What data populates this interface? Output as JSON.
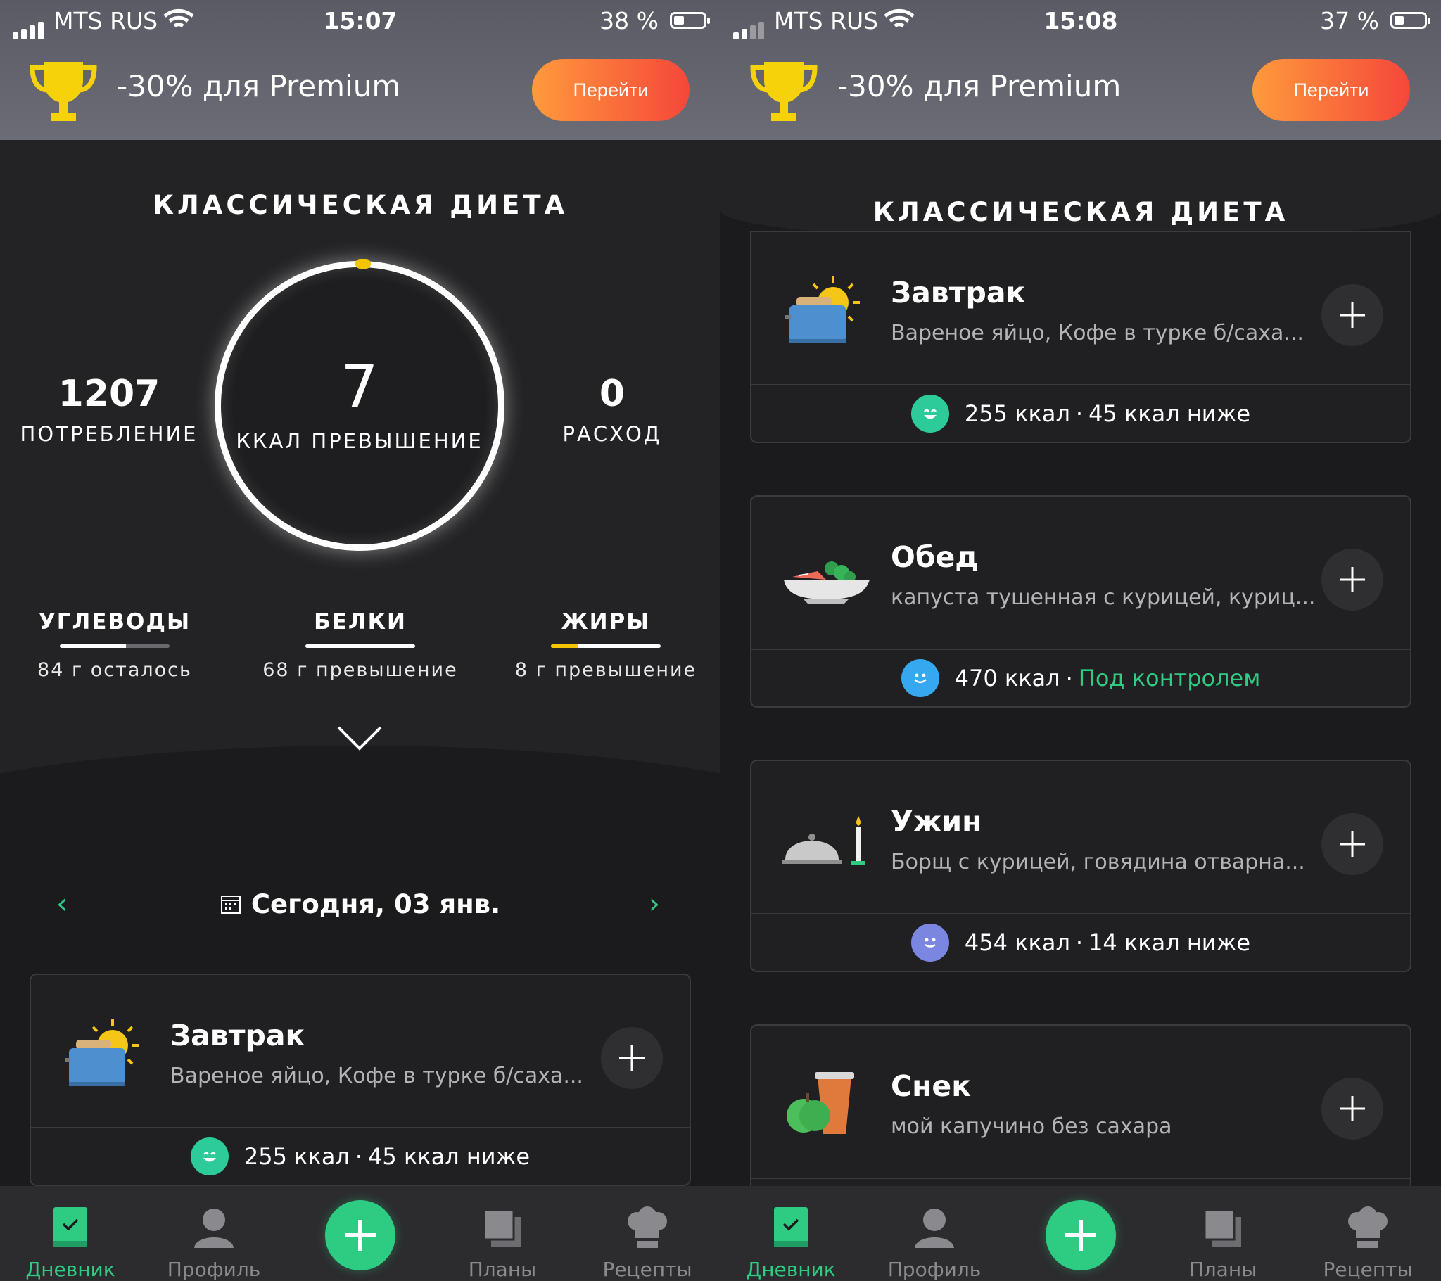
{
  "screens": [
    {
      "status": {
        "carrier": "MTS RUS",
        "time": "15:07",
        "battery": "38 %"
      },
      "premium": {
        "text": "-30% для Premium",
        "button": "Перейти"
      },
      "diet_title": "КЛАССИЧЕСКАЯ ДИЕТА",
      "summary": {
        "intake_value": "1207",
        "intake_label": "ПОТРЕБЛЕНИЕ",
        "ring_value": "7",
        "ring_label": "ККАЛ ПРЕВЫШЕНИЕ",
        "burn_value": "0",
        "burn_label": "РАСХОД"
      },
      "macros": [
        {
          "name": "УГЛЕВОДЫ",
          "text": "84 г осталось",
          "fill": 0.6,
          "color": "#ffffff"
        },
        {
          "name": "БЕЛКИ",
          "text": "68 г превышение",
          "fill": 1.0,
          "color": "#ffffff"
        },
        {
          "name": "ЖИРЫ",
          "text": "8 г превышение",
          "fill": 0.25,
          "color": "#f2c500"
        }
      ],
      "date": "Сегодня, 03 янв.",
      "meals": [
        {
          "name": "Завтрак",
          "desc": "Вареное яйцо, Кофе в турке б/саха...",
          "kcal": "255 ккал",
          "note": "45 ккал ниже",
          "face": "#2ecb9a",
          "ok": false
        }
      ],
      "tabs": [
        "Дневник",
        "Профиль",
        "Планы",
        "Рецепты"
      ]
    },
    {
      "status": {
        "carrier": "MTS RUS",
        "time": "15:08",
        "battery": "37 %"
      },
      "premium": {
        "text": "-30% для Premium",
        "button": "Перейти"
      },
      "diet_title": "КЛАССИЧЕСКАЯ ДИЕТА",
      "meals": [
        {
          "name": "Завтрак",
          "desc": "Вареное яйцо, Кофе в турке б/саха...",
          "kcal": "255 ккал",
          "note": "45 ккал ниже",
          "face": "#2ecb9a",
          "ok": false
        },
        {
          "name": "Обед",
          "desc": "капуста тушенная с курицей, куриц...",
          "kcal": "470 ккал",
          "note": "Под контролем",
          "face": "#35a8f0",
          "ok": true
        },
        {
          "name": "Ужин",
          "desc": "Борщ  с курицей, говядина отварна...",
          "kcal": "454 ккал",
          "note": "14 ккал ниже",
          "face": "#7b86e0",
          "ok": false
        },
        {
          "name": "Снек",
          "desc": "мой капучино без сахара"
        }
      ],
      "tabs": [
        "Дневник",
        "Профиль",
        "Планы",
        "Рецепты"
      ]
    }
  ],
  "colors": {
    "accent": "#2ecb83",
    "premium_gradient_start": "#ff9a3c",
    "premium_gradient_end": "#f5473a",
    "card_bg": "#202022"
  }
}
